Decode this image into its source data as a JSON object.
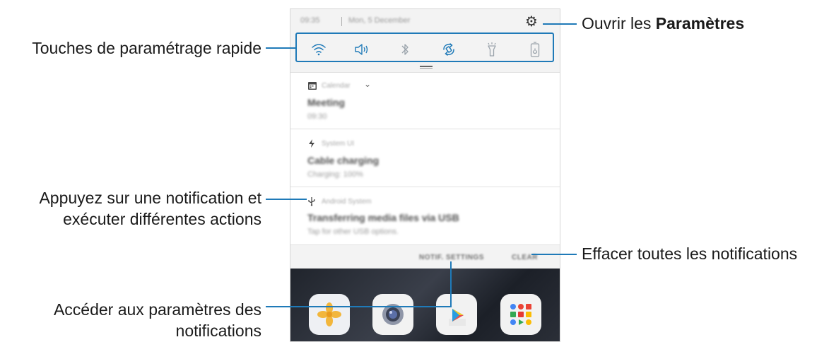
{
  "callouts": {
    "quick_settings": "Touches de paramétrage rapide",
    "open_settings_prefix": "Ouvrir les ",
    "open_settings_bold": "Paramètres",
    "tap_notification_line1": "Appuyez sur une notification et",
    "tap_notification_line2": "exécuter différentes actions",
    "clear_all": "Effacer toutes les notifications",
    "notif_settings_line1": "Accéder aux paramètres des",
    "notif_settings_line2": "notifications"
  },
  "phone": {
    "status_bar": {
      "time": "09:35",
      "date": "Mon, 5 December"
    },
    "quick_settings": [
      "wifi-icon",
      "sound-icon",
      "bluetooth-icon",
      "auto-rotate-icon",
      "flashlight-icon",
      "power-saving-icon"
    ],
    "notifications": [
      {
        "app": "Calendar",
        "title": "Meeting",
        "subtitle": "09:30",
        "icon": "calendar-icon"
      },
      {
        "app": "System UI",
        "title": "Cable charging",
        "subtitle": "Charging: 100%",
        "icon": "lightning-icon"
      },
      {
        "app": "Android System",
        "title": "Transferring media files via USB",
        "subtitle": "Tap for other USB options.",
        "icon": "usb-icon"
      }
    ],
    "actions": {
      "notif_settings": "NOTIF. SETTINGS",
      "clear": "CLEAR"
    }
  },
  "colors": {
    "leader": "#1f7ab8",
    "accent": "#1f7ab8"
  }
}
